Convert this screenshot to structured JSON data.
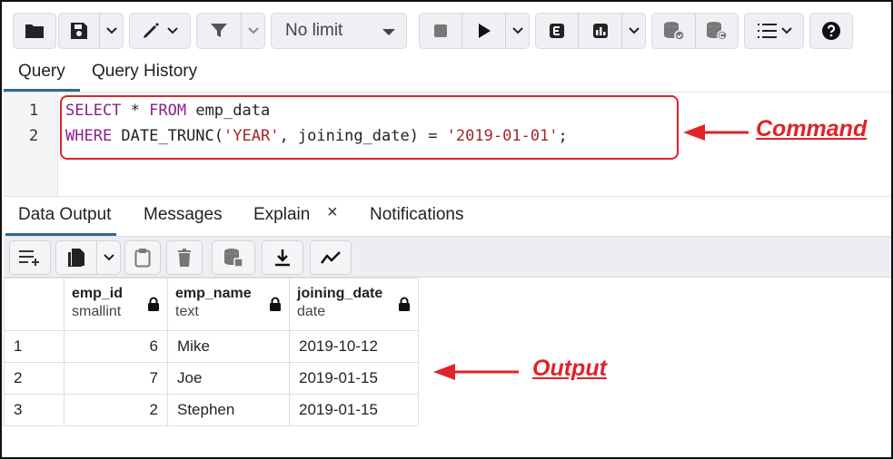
{
  "toolbar": {
    "limit_select": "No limit"
  },
  "query_tabs": [
    {
      "label": "Query",
      "active": true
    },
    {
      "label": "Query History",
      "active": false
    }
  ],
  "editor": {
    "lines": [
      {
        "number": "1",
        "tokens": [
          {
            "text": "SELECT",
            "kind": "keyword"
          },
          {
            "text": " * ",
            "kind": "plain"
          },
          {
            "text": "FROM",
            "kind": "keyword"
          },
          {
            "text": " emp_data",
            "kind": "plain"
          }
        ]
      },
      {
        "number": "2",
        "tokens": [
          {
            "text": "WHERE",
            "kind": "keyword"
          },
          {
            "text": " DATE_TRUNC(",
            "kind": "plain"
          },
          {
            "text": "'YEAR'",
            "kind": "string"
          },
          {
            "text": ", joining_date) = ",
            "kind": "plain"
          },
          {
            "text": "'2019-01-01'",
            "kind": "string"
          },
          {
            "text": ";",
            "kind": "plain"
          }
        ]
      }
    ]
  },
  "annotations": {
    "command": "Command",
    "output": "Output"
  },
  "output_tabs": [
    {
      "label": "Data Output",
      "active": true
    },
    {
      "label": "Messages",
      "active": false
    },
    {
      "label": "Explain",
      "active": false,
      "closable": true
    },
    {
      "label": "Notifications",
      "active": false
    }
  ],
  "output_tab_close": "×",
  "grid": {
    "columns": [
      {
        "name": "emp_id",
        "type": "smallint"
      },
      {
        "name": "emp_name",
        "type": "text"
      },
      {
        "name": "joining_date",
        "type": "date"
      }
    ],
    "rows": [
      {
        "row": "1",
        "emp_id": "6",
        "emp_name": "Mike",
        "joining_date": "2019-10-12"
      },
      {
        "row": "2",
        "emp_id": "7",
        "emp_name": "Joe",
        "joining_date": "2019-01-15"
      },
      {
        "row": "3",
        "emp_id": "2",
        "emp_name": "Stephen",
        "joining_date": "2019-01-15"
      }
    ]
  },
  "colors": {
    "accent": "#326690",
    "annotation": "#e0222a",
    "keyword": "#8b1e8b",
    "string": "#a0282a"
  }
}
